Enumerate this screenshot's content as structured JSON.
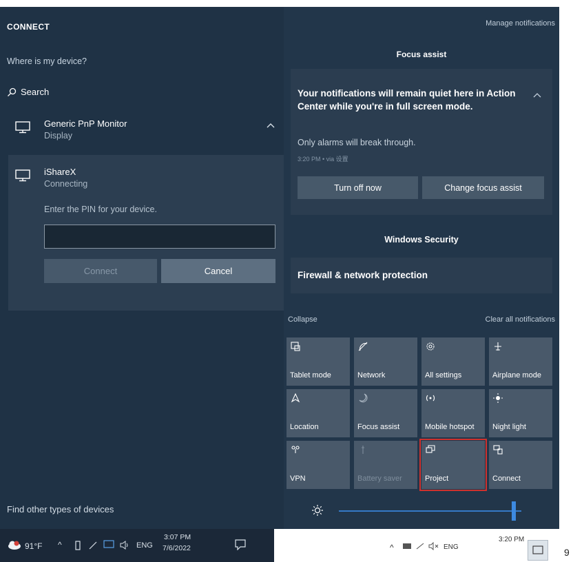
{
  "connect": {
    "title": "CONNECT",
    "where_link": "Where is my device?",
    "search_label": "Search",
    "devices": [
      {
        "name": "Generic PnP Monitor",
        "sub": "Display"
      },
      {
        "name": "iShareX",
        "sub": "Connecting"
      }
    ],
    "pin_prompt": "Enter the PIN for your device.",
    "pin_value": "",
    "connect_button": "Connect",
    "cancel_button": "Cancel",
    "find_other": "Find other types of devices"
  },
  "taskbar_left": {
    "temperature": "91°F",
    "language": "ENG",
    "time": "3:07 PM",
    "date": "7/6/2022"
  },
  "action_center": {
    "manage_notifications": "Manage notifications",
    "focus_header": "Focus assist",
    "focus_message": "Your notifications will remain quiet here in Action Center while you're in full screen mode.",
    "focus_sub": "Only alarms will break through.",
    "focus_time": "3:20 PM • via 设置",
    "turn_off_button": "Turn off now",
    "change_focus_button": "Change focus assist",
    "security_header": "Windows Security",
    "security_title": "Firewall & network protection",
    "collapse": "Collapse",
    "clear_all": "Clear all notifications",
    "tiles": [
      {
        "label": "Tablet mode",
        "icon": "tablet-mode-icon"
      },
      {
        "label": "Network",
        "icon": "network-icon"
      },
      {
        "label": "All settings",
        "icon": "gear-icon"
      },
      {
        "label": "Airplane mode",
        "icon": "airplane-icon"
      },
      {
        "label": "Location",
        "icon": "location-icon"
      },
      {
        "label": "Focus assist",
        "icon": "moon-icon"
      },
      {
        "label": "Mobile hotspot",
        "icon": "hotspot-icon"
      },
      {
        "label": "Night light",
        "icon": "sun-icon"
      },
      {
        "label": "VPN",
        "icon": "vpn-icon"
      },
      {
        "label": "Battery saver",
        "icon": "battery-saver-icon"
      },
      {
        "label": "Project",
        "icon": "project-icon"
      },
      {
        "label": "Connect",
        "icon": "connect-icon"
      }
    ],
    "brightness_level": 0.96
  },
  "taskbar_right": {
    "language": "ENG",
    "time": "3:20 PM"
  },
  "colors": {
    "panel_bg": "#1f3245",
    "tile_bg": "#49596a",
    "accent": "#3d8ae0",
    "highlight_box": "#d0312d"
  },
  "page_number": "9"
}
